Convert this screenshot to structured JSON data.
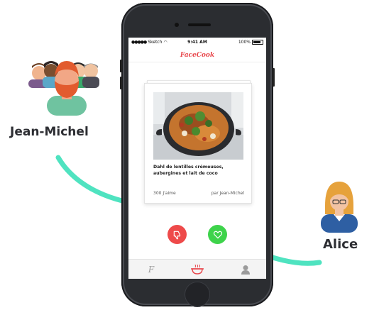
{
  "statusbar": {
    "carrier": "Sketch",
    "time": "9:41 AM",
    "battery": "100%"
  },
  "app": {
    "brand": "FaceCook"
  },
  "card": {
    "title": "Dahl de lentilles crémeuses, aubergines et lait de coco",
    "likes": "300 J'aime",
    "author": "par Jean-Michel"
  },
  "actions": {
    "dislike_icon": "thumbs-down-icon",
    "like_icon": "heart-icon"
  },
  "tabs": [
    "brand-f-icon",
    "cooking-pot-icon",
    "profile-icon"
  ],
  "people": {
    "left": "Jean-Michel",
    "right": "Alice"
  },
  "colors": {
    "brand": "#e8474c",
    "dislike": "#ee4a4a",
    "like": "#3ed34b",
    "arrow": "#4fe3c0"
  }
}
